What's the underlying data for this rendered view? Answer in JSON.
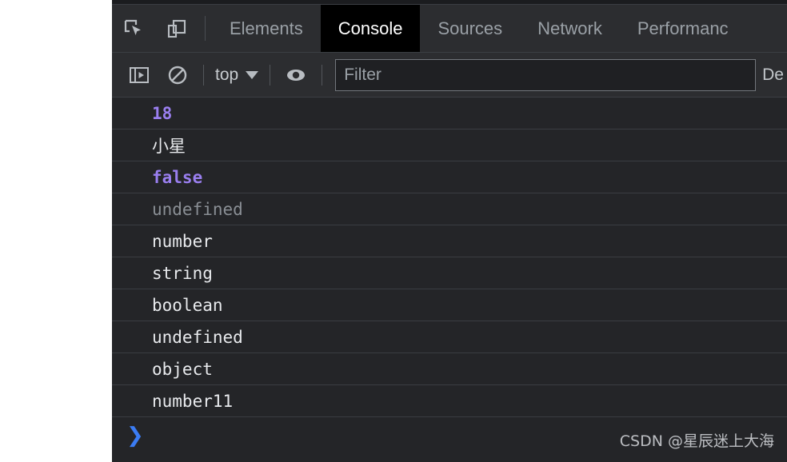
{
  "devtools": {
    "tab_icons": [
      {
        "name": "inspect-element-icon",
        "label": "Inspect element"
      },
      {
        "name": "device-toolbar-icon",
        "label": "Toggle device toolbar"
      }
    ],
    "tabs": [
      {
        "label": "Elements",
        "active": false
      },
      {
        "label": "Console",
        "active": true
      },
      {
        "label": "Sources",
        "active": false
      },
      {
        "label": "Network",
        "active": false
      },
      {
        "label": "Performanc",
        "active": false
      }
    ],
    "toolbar": {
      "sidebar_toggle_icon": "console-sidebar-icon",
      "clear_console_icon": "clear-console-icon",
      "context_value": "top",
      "eye_icon": "eye-icon",
      "filter_placeholder": "Filter",
      "filter_value": "",
      "levels_label": "De"
    },
    "console_rows": [
      {
        "text": "18",
        "kind": "num"
      },
      {
        "text": "小星",
        "kind": "str"
      },
      {
        "text": "false",
        "kind": "bool"
      },
      {
        "text": "undefined",
        "kind": "undef"
      },
      {
        "text": "number",
        "kind": "str"
      },
      {
        "text": "string",
        "kind": "str"
      },
      {
        "text": "boolean",
        "kind": "str"
      },
      {
        "text": "undefined",
        "kind": "str"
      },
      {
        "text": "object",
        "kind": "str"
      },
      {
        "text": "number11",
        "kind": "str"
      }
    ],
    "prompt": {
      "chevron": "❯"
    },
    "watermark": "CSDN @星辰迷上大海"
  },
  "colors": {
    "panel_bg": "#242528",
    "chrome_bg": "#2c2d30",
    "active_tab_bg": "#000000",
    "purple_literal": "#9a7ff0",
    "gray_undefined": "#8a8f95",
    "prompt_blue": "#3b7cf4",
    "row_separator": "#3a3d42"
  }
}
